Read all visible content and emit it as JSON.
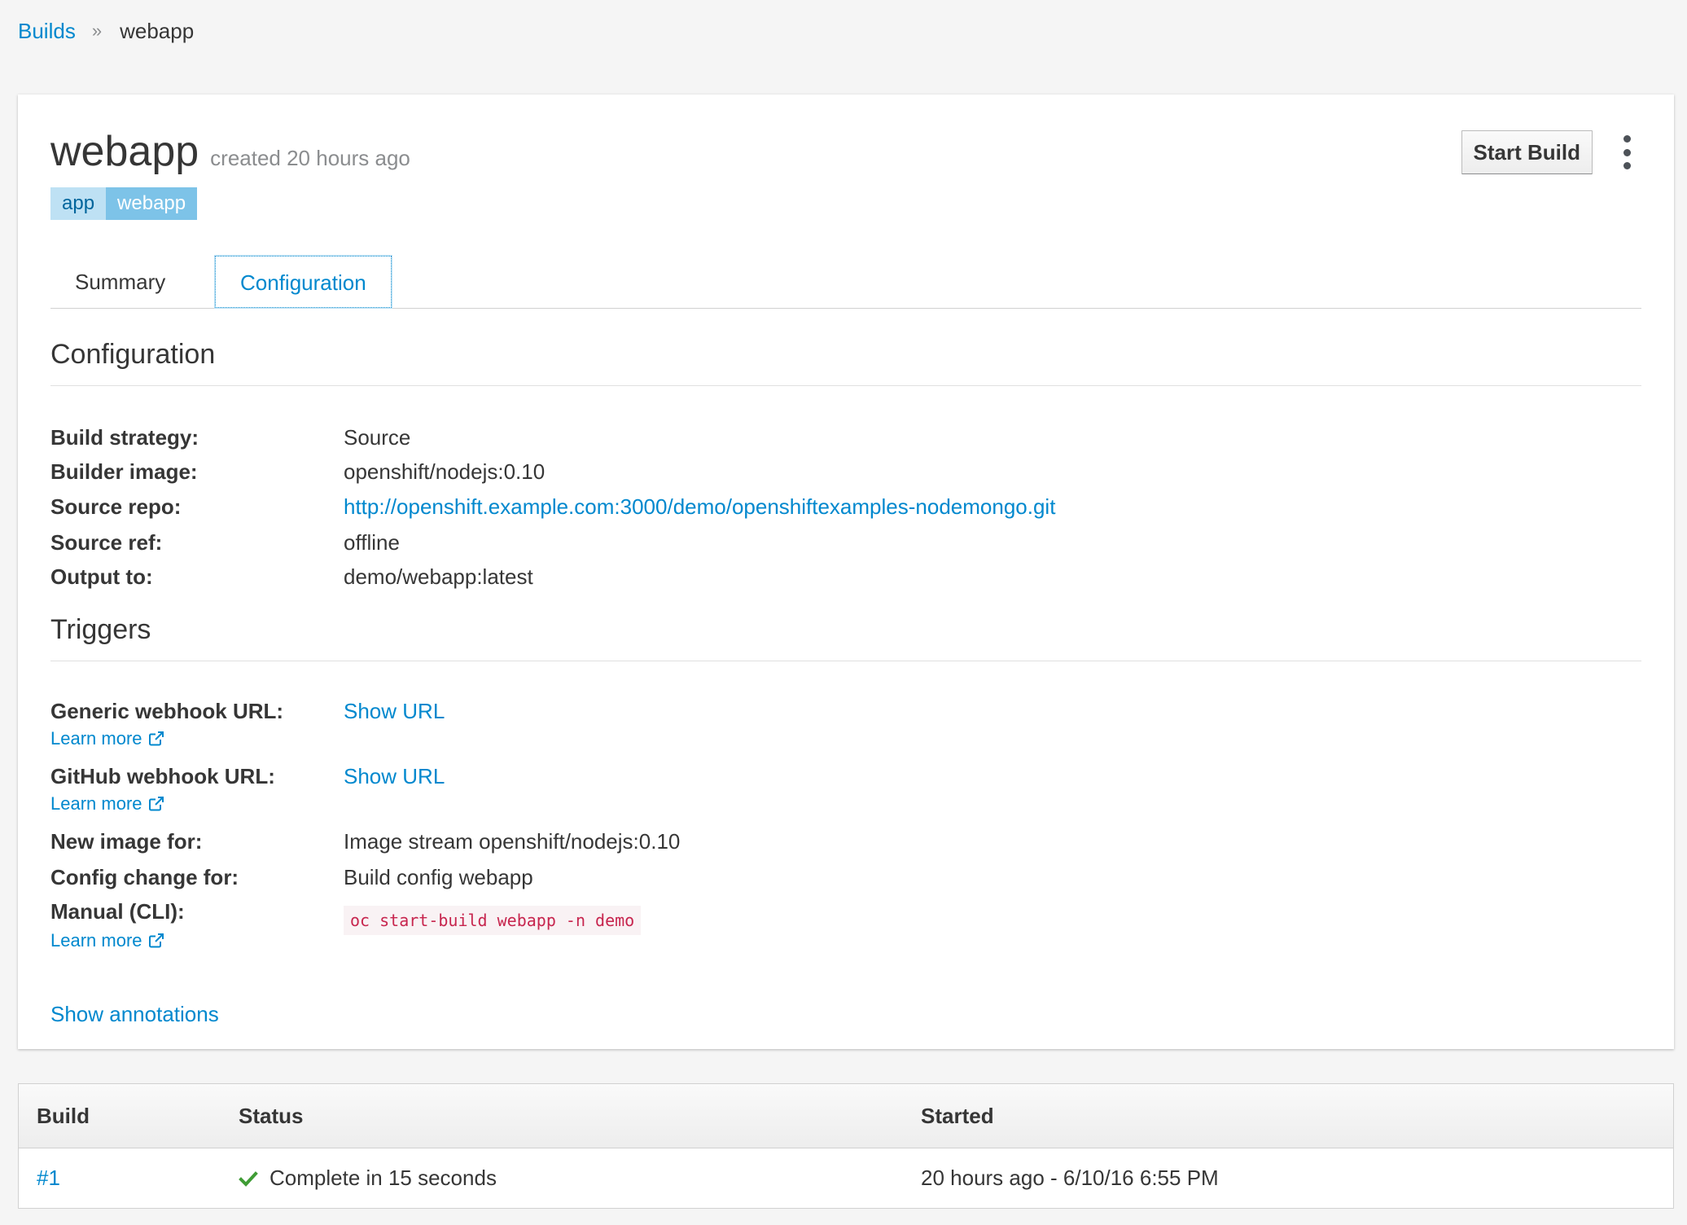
{
  "breadcrumb": {
    "parent": "Builds",
    "separator": "»",
    "current": "webapp"
  },
  "header": {
    "title": "webapp",
    "created": "created 20 hours ago",
    "label_key": "app",
    "label_value": "webapp",
    "start_build": "Start Build",
    "kebab_icon": "kebab-menu-icon"
  },
  "tabs": [
    {
      "label": "Summary",
      "active": false
    },
    {
      "label": "Configuration",
      "active": true
    }
  ],
  "configuration": {
    "heading": "Configuration",
    "rows": [
      {
        "label": "Build strategy:",
        "value": "Source"
      },
      {
        "label": "Builder image:",
        "value": "openshift/nodejs:0.10"
      },
      {
        "label": "Source repo:",
        "value": "http://openshift.example.com:3000/demo/openshiftexamples-nodemongo.git"
      },
      {
        "label": "Source ref:",
        "value": "offline"
      },
      {
        "label": "Output to:",
        "value": "demo/webapp:latest"
      }
    ]
  },
  "triggers": {
    "heading": "Triggers",
    "generic_label": "Generic webhook URL:",
    "generic_value": "Show URL",
    "github_label": "GitHub webhook URL:",
    "github_value": "Show URL",
    "new_image_label": "New image for:",
    "new_image_value": "Image stream openshift/nodejs:0.10",
    "config_change_label": "Config change for:",
    "config_change_value": "Build config webapp",
    "manual_label": "Manual (CLI):",
    "manual_value": "oc start-build webapp -n demo",
    "learn_more": "Learn more",
    "learn_more_icon": "external-link-icon"
  },
  "show_annotations": "Show annotations",
  "builds_table": {
    "headers": [
      "Build",
      "Status",
      "Started"
    ],
    "rows": [
      {
        "build": "#1",
        "status": "Complete in 15 seconds",
        "status_icon": "checkmark-icon",
        "started": "20 hours ago - 6/10/16 6:55 PM"
      }
    ]
  },
  "colors": {
    "link": "#0088ce",
    "success": "#3f9c35",
    "label_key_bg": "#bee1f4",
    "label_value_bg": "#7dc3e8",
    "code_text": "#c7254e"
  }
}
